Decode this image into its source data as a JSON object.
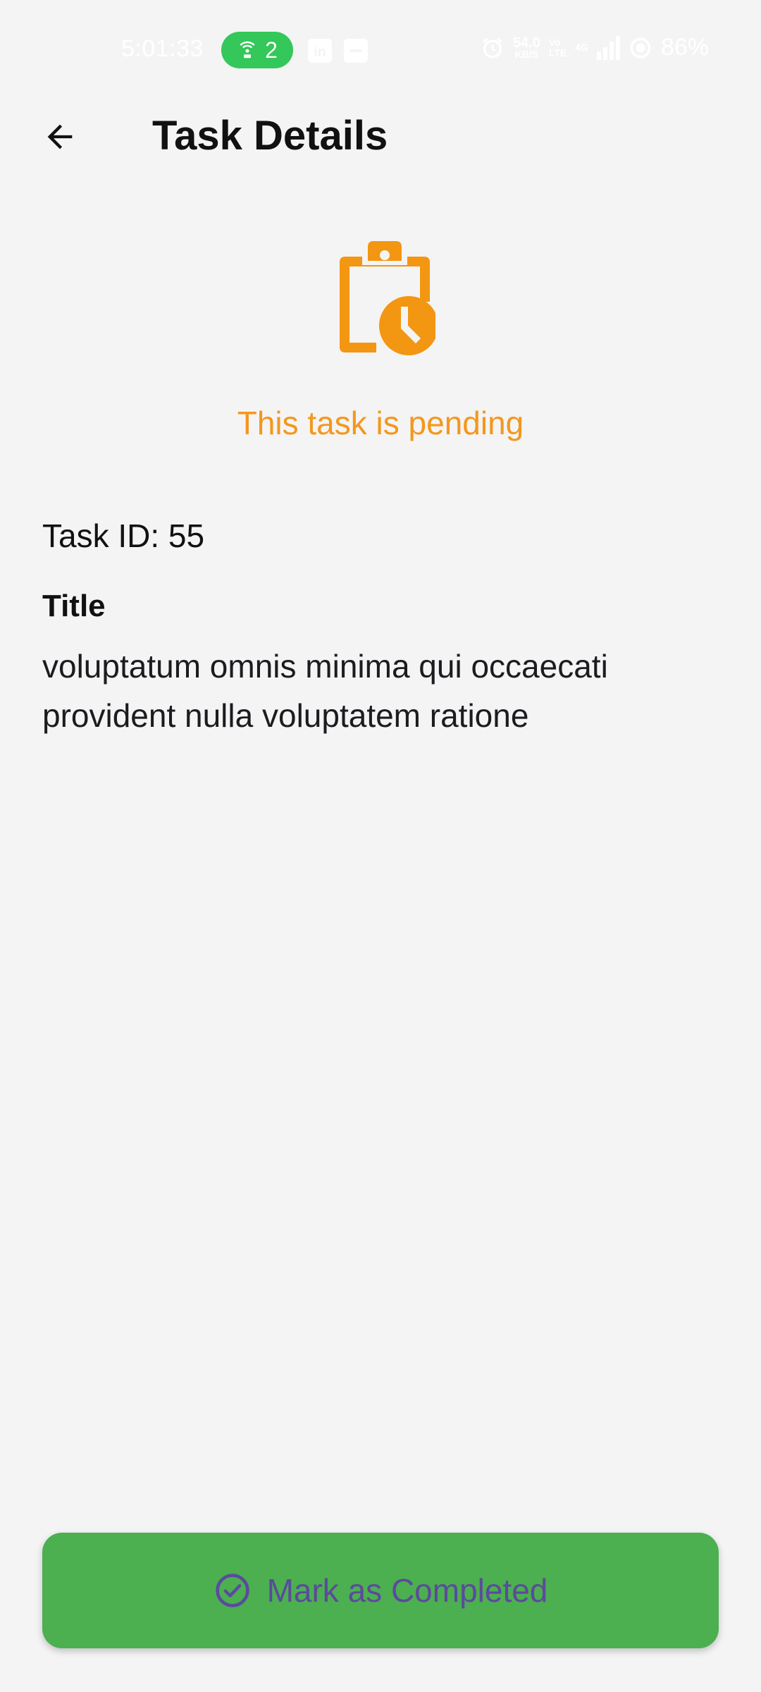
{
  "status_bar": {
    "time": "5:01:33",
    "hotspot_count": "2",
    "net_speed": "54.0",
    "net_speed_unit": "KB/S",
    "net_type_top": "Vo",
    "net_type_bottom": "LTE",
    "signal_gen": "4G",
    "battery": "86%",
    "icons": [
      "hotspot-icon",
      "linkedin-icon",
      "message-icon",
      "alarm-icon",
      "signal-icon",
      "battery-icon"
    ]
  },
  "app_bar": {
    "back_icon": "arrow-back-icon",
    "title": "Task Details"
  },
  "status": {
    "icon": "pending-clipboard-clock-icon",
    "message": "This task is pending",
    "color": "#f4971d"
  },
  "task": {
    "id_text": "Task ID: 55",
    "title_label": "Title",
    "title_value": "voluptatum omnis minima qui occaecati provident nulla voluptatem ratione"
  },
  "action": {
    "icon": "check-circle-icon",
    "label": "Mark as Completed",
    "background": "#4caf50",
    "text_color": "#5b4a9e"
  }
}
